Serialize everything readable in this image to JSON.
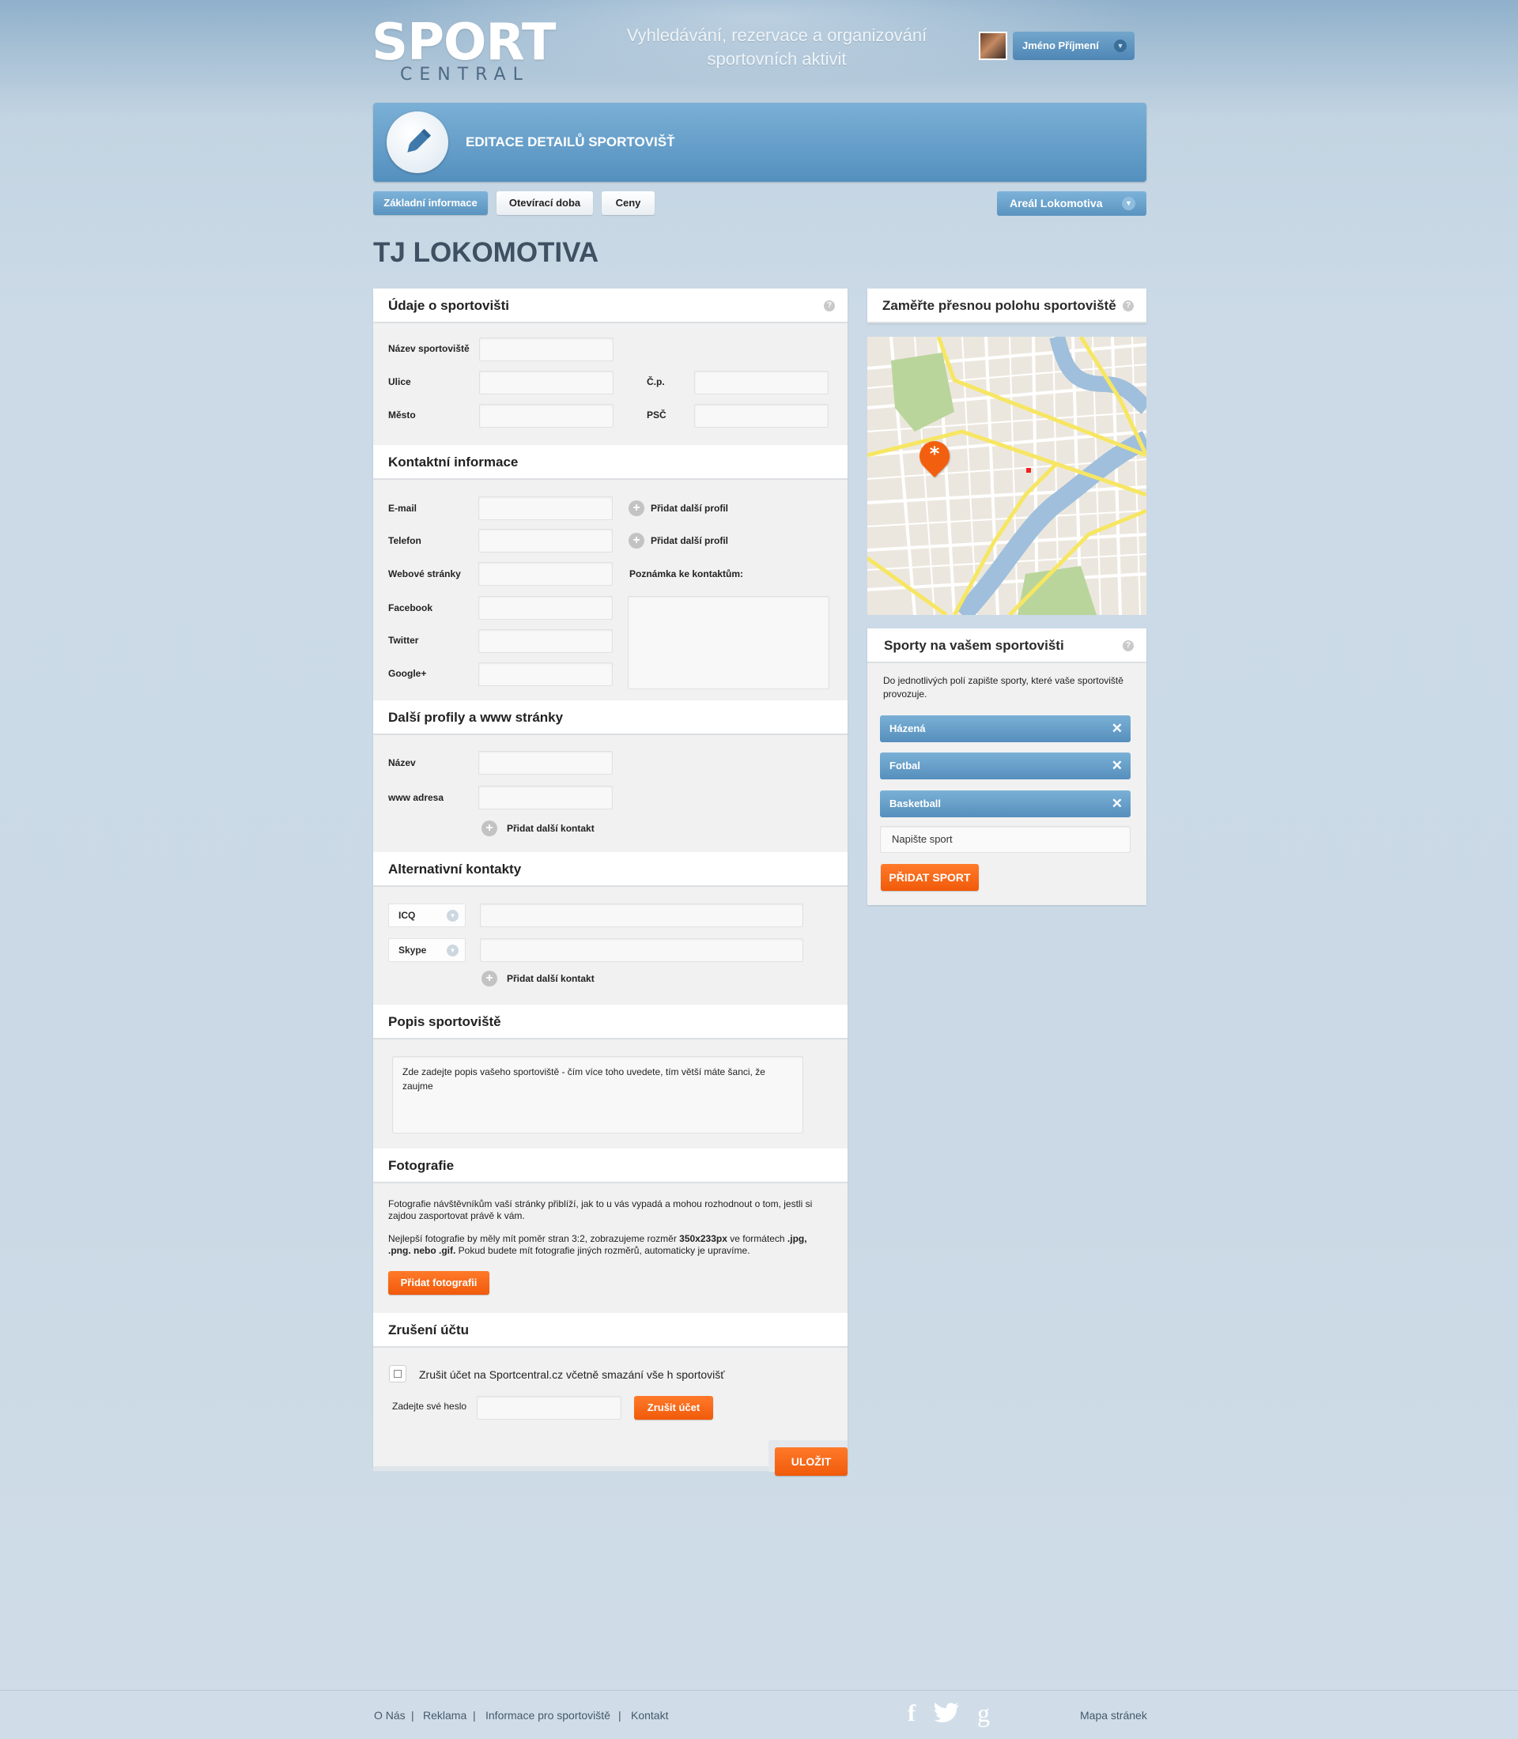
{
  "header": {
    "logo_top": "SPORT",
    "logo_bottom": "CENTRAL",
    "tagline_line1": "Vyhledávání, rezervace a organizování",
    "tagline_line2": "sportovních aktivit",
    "user_name": "Jméno Příjmení"
  },
  "banner": {
    "title": "EDITACE DETAILŮ SPORTOVIŠŤ"
  },
  "tabs": [
    {
      "label": "Základní informace",
      "active": true
    },
    {
      "label": "Otevírací doba",
      "active": false
    },
    {
      "label": "Ceny",
      "active": false
    }
  ],
  "venue_selector": "Areál Lokomotiva",
  "page_title": "TJ LOKOMOTIVA",
  "sections": {
    "udaje": {
      "title": "Údaje o sportovišti",
      "nazev": "Název sportoviště",
      "ulice": "Ulice",
      "cp": "Č.p.",
      "mesto": "Město",
      "psc": "PSČ"
    },
    "kontakt": {
      "title": "Kontaktní informace",
      "email": "E-mail",
      "telefon": "Telefon",
      "web": "Webové stránky",
      "facebook": "Facebook",
      "twitter": "Twitter",
      "google": "Google+",
      "add_profile": "Přidat další profil",
      "note_label": "Poznámka ke kontaktům:"
    },
    "profily": {
      "title": "Další profily a www stránky",
      "nazev": "Název",
      "www": "www adresa",
      "add_contact": "Přidat další kontakt"
    },
    "alternativni": {
      "title": "Alternativní kontakty",
      "options": [
        "ICQ",
        "Skype"
      ],
      "add_contact": "Přidat další kontakt"
    },
    "popis": {
      "title": "Popis sportoviště",
      "placeholder": "Zde zadejte popis vašeho sportoviště - čím více toho uvedete, tím větší máte šanci, že zaujme"
    },
    "foto": {
      "title": "Fotografie",
      "text1": "Fotografie návštěvníkům vaší stránky přiblíží, jak to u vás vypadá a mohou rozhodnout o tom, jestli si zajdou zasportovat právě k vám.",
      "text2a": "Nejlepší fotografie by měly mít poměr stran 3:2, zobrazujeme rozměr ",
      "text2b": "350x233px",
      "text2c": " ve formátech ",
      "text2d": ".jpg, .png. nebo .gif.",
      "text2e": " Pokud budete mít fotografie jiných rozměrů, automaticky je upravíme.",
      "button": "Přidat fotografii"
    },
    "zruseni": {
      "title": "Zrušení účtu",
      "checkbox_label": "Zrušit účet na Sportcentral.cz včetně smazání vše h sportovišť",
      "password_label": "Zadejte své heslo",
      "button": "Zrušit účet"
    }
  },
  "save_button": "ULOŽIT",
  "map": {
    "title": "Zaměřte přesnou polohu sportoviště"
  },
  "sports": {
    "title": "Sporty na vašem sportovišti",
    "description": "Do jednotlivých polí zapište sporty, které vaše sportoviště provozuje.",
    "items": [
      "Házená",
      "Fotbal",
      "Basketball"
    ],
    "input_placeholder": "Napište sport",
    "button": "PŘIDAT SPORT"
  },
  "footer": {
    "links": [
      "O Nás",
      "Reklama",
      "Informace pro sportoviště",
      "Kontakt"
    ],
    "sitemap": "Mapa stránek"
  },
  "colors": {
    "accent_blue": "#5a93c0",
    "accent_orange": "#f2600f",
    "background": "#cad9e5"
  },
  "icons": [
    "pencil-icon",
    "help-icon",
    "plus-icon",
    "chevron-down-icon",
    "close-icon",
    "map-pin-icon",
    "facebook-icon",
    "twitter-icon",
    "google-plus-icon"
  ]
}
